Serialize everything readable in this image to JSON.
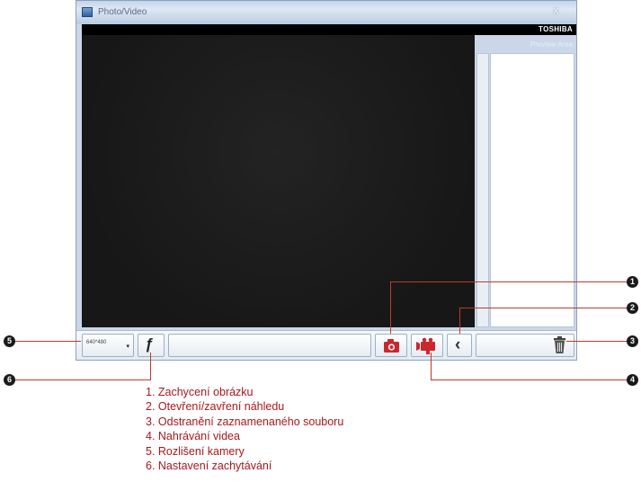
{
  "window": {
    "title": "Photo/Video",
    "close_glyph": "x",
    "brand": "TOSHIBA",
    "preview_label": "Preview Area"
  },
  "toolbar": {
    "resolution_value": "640*480",
    "resolution_caret": "▾",
    "settings_glyph": "ƒ",
    "back_glyph": "‹"
  },
  "icons": {
    "photo": "camera-icon",
    "video": "video-camera-icon",
    "back": "chevron-left-icon",
    "delete": "trash-icon",
    "settings": "wrench-icon"
  },
  "colors": {
    "accent_red": "#c0392b",
    "legend_text": "#a8171c",
    "camera_red": "#c8282e",
    "video_bg": "#191919"
  },
  "callouts": [
    "1",
    "2",
    "3",
    "4",
    "5",
    "6"
  ],
  "legend": [
    "1. Zachycení obrázku",
    "2. Otevření/zavření náhledu",
    "3. Odstranění zaznamenaného souboru",
    "4. Nahrávání videa",
    "5. Rozlišení kamery",
    "6. Nastavení zachytávání"
  ]
}
